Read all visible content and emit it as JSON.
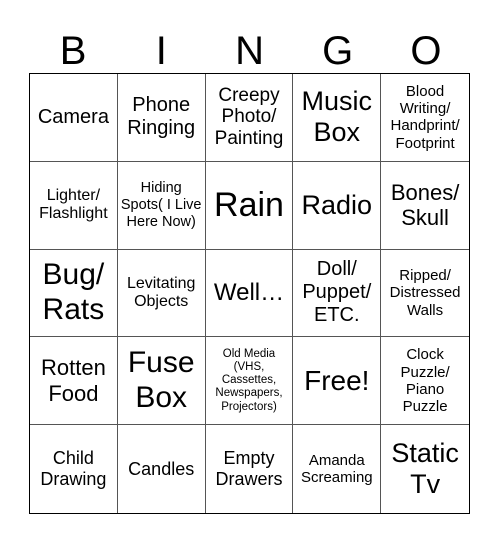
{
  "header": {
    "letters": [
      "B",
      "I",
      "N",
      "G",
      "O"
    ]
  },
  "cells": [
    "Camera",
    "Phone Ringing",
    "Creepy Photo/ Painting",
    "Music Box",
    "Blood Writing/ Handprint/ Footprint",
    "Lighter/ Flashlight",
    "Hiding Spots( I Live Here Now)",
    "Rain",
    "Radio",
    "Bones/ Skull",
    "Bug/ Rats",
    "Levitating Objects",
    "Well…",
    "Doll/ Puppet/ ETC.",
    "Ripped/ Distressed Walls",
    "Rotten Food",
    "Fuse Box",
    "Old Media (VHS, Cassettes, Newspapers, Projectors)",
    "Free!",
    "Clock Puzzle/ Piano Puzzle",
    "Child Drawing",
    "Candles",
    "Empty Drawers",
    "Amanda Screaming",
    "Static Tv"
  ]
}
